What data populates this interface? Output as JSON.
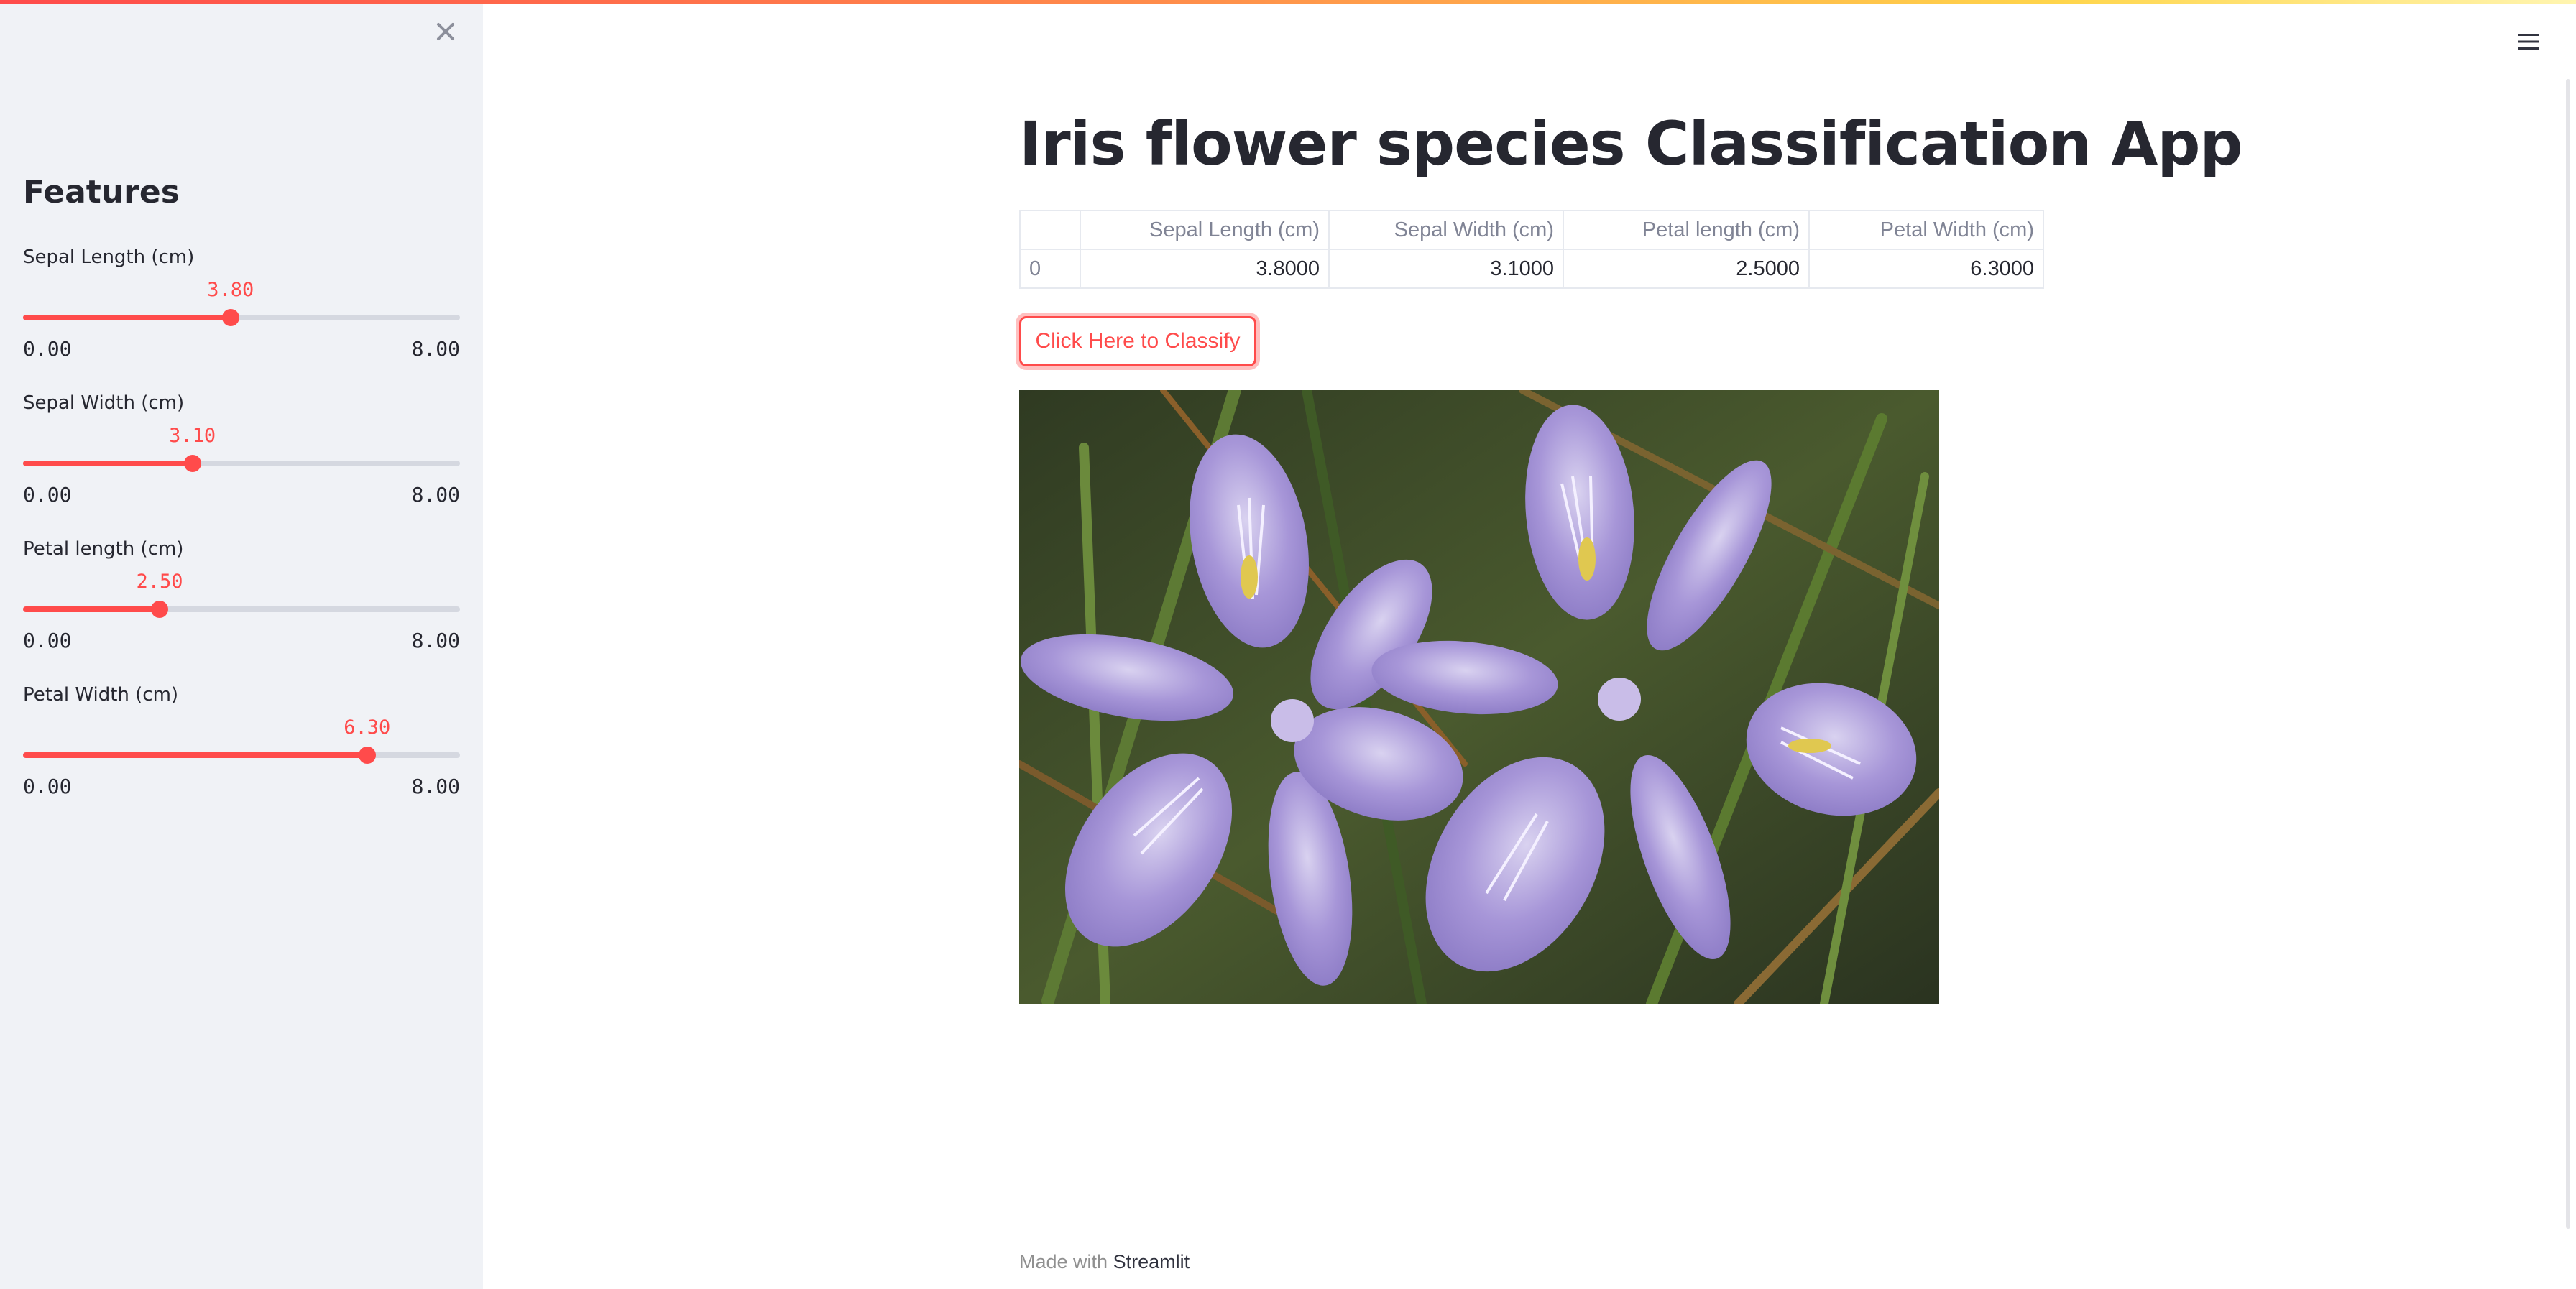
{
  "sidebar": {
    "title": "Features",
    "sliders": [
      {
        "label": "Sepal Length (cm)",
        "value": "3.80",
        "fraction": 0.475,
        "min": "0.00",
        "max": "8.00"
      },
      {
        "label": "Sepal Width (cm)",
        "value": "3.10",
        "fraction": 0.3875,
        "min": "0.00",
        "max": "8.00"
      },
      {
        "label": "Petal length (cm)",
        "value": "2.50",
        "fraction": 0.3125,
        "min": "0.00",
        "max": "8.00"
      },
      {
        "label": "Petal Width (cm)",
        "value": "6.30",
        "fraction": 0.7875,
        "min": "0.00",
        "max": "8.00"
      }
    ]
  },
  "main": {
    "title": "Iris flower species Classification App",
    "table": {
      "headers": [
        "",
        "Sepal Length (cm)",
        "Sepal Width (cm)",
        "Petal length (cm)",
        "Petal Width (cm)"
      ],
      "rows": [
        [
          "0",
          "3.8000",
          "3.1000",
          "2.5000",
          "6.3000"
        ]
      ]
    },
    "classify_button": "Click Here to Classify"
  },
  "footer": {
    "prefix": "Made with",
    "link": "Streamlit"
  },
  "colors": {
    "accent": "#ff4b4b",
    "sidebar_bg": "#f0f2f6",
    "text": "#262730"
  },
  "icons": {
    "close": "close-icon",
    "menu": "hamburger-menu-icon"
  }
}
